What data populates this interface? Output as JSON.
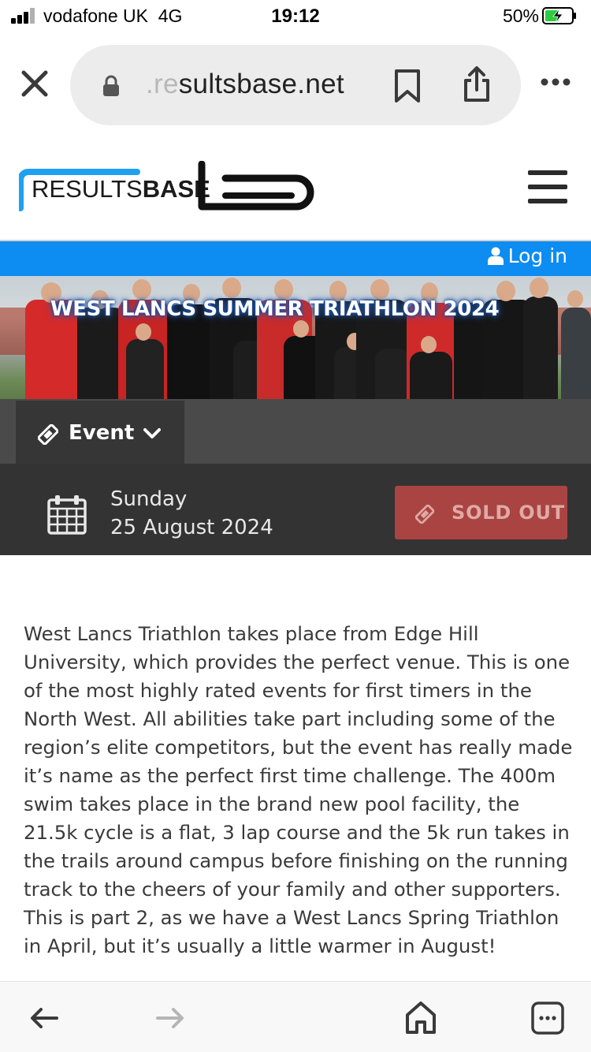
{
  "status_bar": {
    "carrier": "vodafone UK",
    "network": "4G",
    "time": "19:12",
    "battery": "50%",
    "signal_bars": 3
  },
  "browser": {
    "url_faded": ".re",
    "url_main": "sultsbase.net",
    "icons": [
      "close-icon",
      "lock-icon",
      "bookmark-icon",
      "share-icon",
      "more-icon"
    ]
  },
  "header": {
    "logo_text_light": "RESULTS",
    "logo_text_bold": "BASE",
    "menu_icon": "hamburger-icon"
  },
  "login_bar": {
    "login_label": "Log in",
    "color": "#0d8cf2"
  },
  "hero": {
    "title": "WEST LANCS SUMMER TRIATHLON 2024"
  },
  "event_tab": {
    "label": "Event",
    "icons": [
      "ticket-icon",
      "chevron-down-icon"
    ]
  },
  "event_date": {
    "day": "Sunday",
    "date": "25 August 2024",
    "sold_out_label": "SOLD OUT",
    "sold_out_color": "#a94442"
  },
  "description": "West Lancs Triathlon takes place from Edge Hill University, which provides the perfect venue. This is one of the most highly rated events for first timers in the North West. All abilities take part including some of the region’s elite competitors, but the event has really made it’s name as the perfect first time challenge. The 400m swim takes place in the brand new pool facility, the 21.5k cycle is a flat, 3 lap course and the 5k run takes in the trails around campus before finishing on the running track to the cheers of your family and other supporters. This is part 2, as we have a West Lancs Spring Triathlon in April, but it’s usually a little warmer in August!",
  "bottom_toolbar": {
    "icons": [
      "back-arrow-icon",
      "forward-arrow-icon",
      "home-icon",
      "tabs-icon"
    ]
  }
}
